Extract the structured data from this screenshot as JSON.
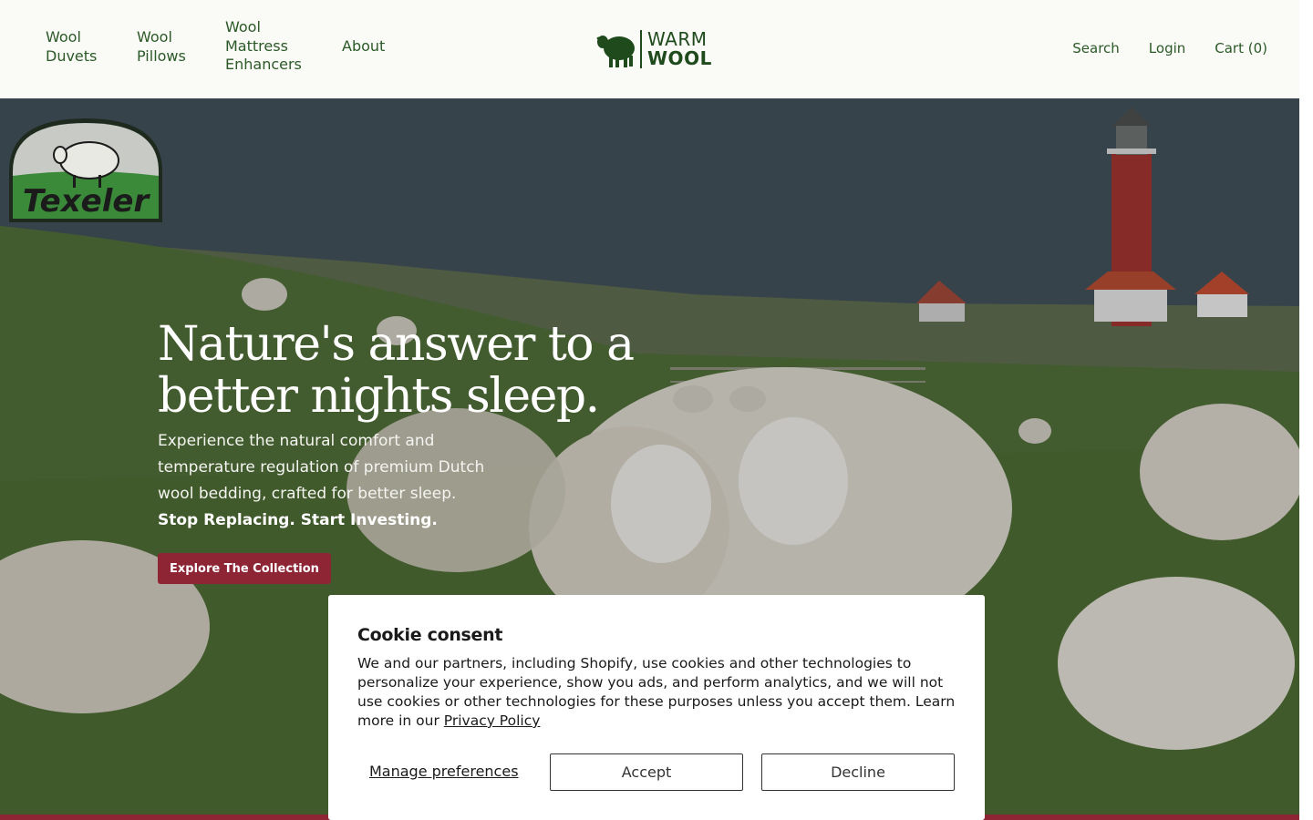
{
  "header": {
    "nav_left": [
      {
        "label": "Wool\nDuvets"
      },
      {
        "label": "Wool\nPillows"
      },
      {
        "label": "Wool\nMattress\nEnhancers"
      },
      {
        "label": "About"
      }
    ],
    "logo": {
      "line1": "WARM",
      "line2": "WOOL",
      "icon": "sheep-icon"
    },
    "nav_right": {
      "search": "Search",
      "login": "Login",
      "cart": "Cart (0)"
    }
  },
  "hero": {
    "badge": {
      "text": "Texeler",
      "icon": "sheep-badge-icon"
    },
    "title": "Nature's answer to a\nbetter nights sleep.",
    "subtitle": "Experience the natural comfort and temperature regulation of premium Dutch wool bedding, crafted for better sleep.",
    "subtitle_bold": "Stop Replacing. Start Investing.",
    "cta": "Explore The Collection"
  },
  "cookie": {
    "title": "Cookie consent",
    "body": "We and our partners, including Shopify, use cookies and other technologies to personalize your experience, show you ads, and perform analytics, and we will not use cookies or other technologies for these purposes unless you accept them. Learn more in our",
    "privacy_link": "Privacy Policy",
    "manage": "Manage preferences",
    "accept": "Accept",
    "decline": "Decline"
  },
  "colors": {
    "brand_green": "#1f4a1c",
    "accent_red": "#8e2535",
    "header_bg": "#fafaf7"
  }
}
